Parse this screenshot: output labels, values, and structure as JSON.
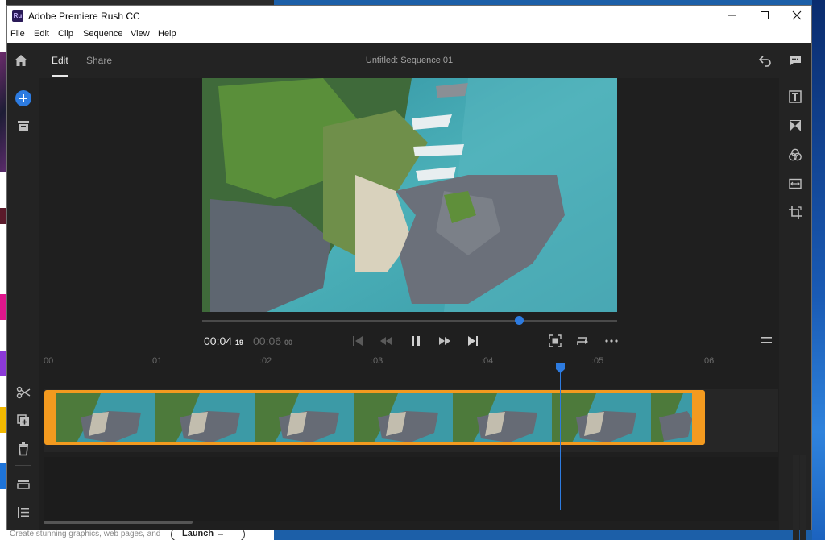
{
  "window": {
    "title": "Adobe Premiere Rush CC",
    "app_icon_text": "Ru",
    "controls": [
      "minimize",
      "maximize",
      "close"
    ]
  },
  "menubar": [
    "File",
    "Edit",
    "Clip",
    "Sequence",
    "View",
    "Help"
  ],
  "topbar": {
    "tabs": [
      {
        "label": "Edit",
        "active": true
      },
      {
        "label": "Share",
        "active": false
      }
    ],
    "sequence_title": "Untitled: Sequence 01"
  },
  "player": {
    "current_time": "00:04",
    "current_frames": "19",
    "total_time": "00:06",
    "total_frames": "00",
    "progress_fraction": 0.76
  },
  "timeline": {
    "ruler_labels": [
      "00",
      ":01",
      ":02",
      ":03",
      ":04",
      ":05",
      ":06"
    ],
    "playhead_fraction": 0.795
  },
  "desktop": {
    "hint_text": "Create stunning graphics, web pages, and",
    "launch_label": "Launch →"
  },
  "colors": {
    "accent_blue": "#2d7be0",
    "clip_orange": "#f39a1f",
    "panel_dark": "#1f1f1f"
  }
}
